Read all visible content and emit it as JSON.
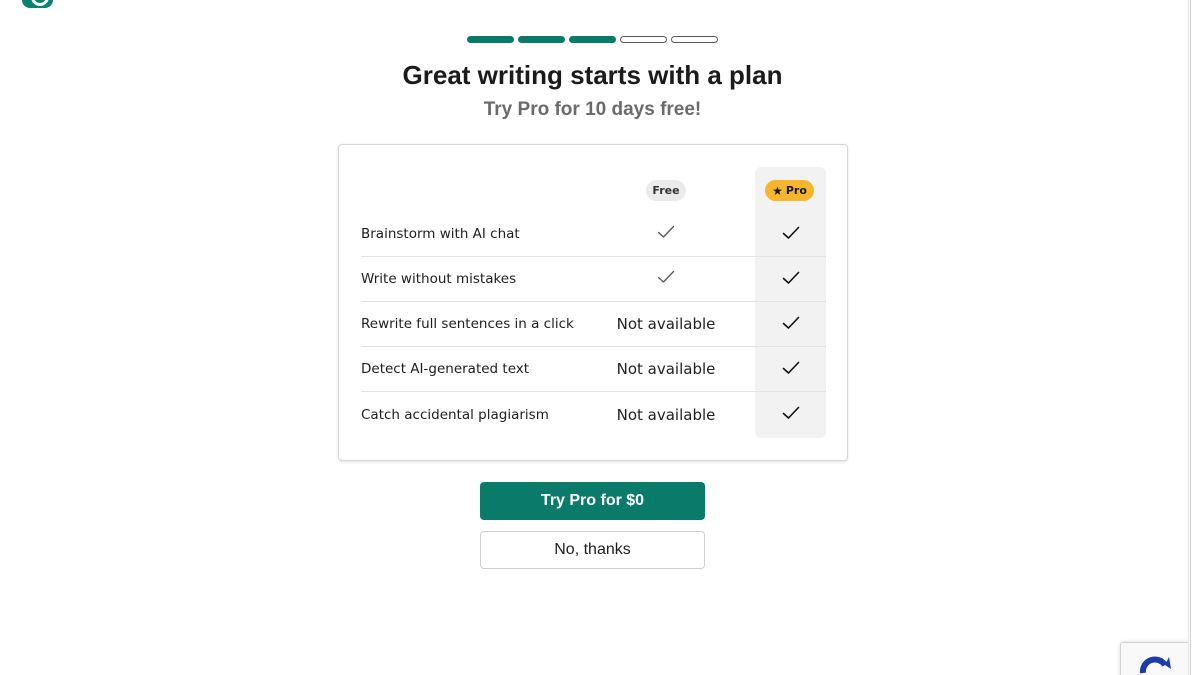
{
  "brand": {
    "name": "grammarly",
    "color": "#0a7b6b"
  },
  "progress": {
    "total_steps": 5,
    "completed_steps": 3
  },
  "header": {
    "title": "Great writing starts with a plan",
    "subtitle": "Try Pro for 10 days free!"
  },
  "plans": {
    "free_label": "Free",
    "pro_label": "Pro",
    "pro_badge_color": "#f6b52d"
  },
  "features": [
    {
      "name": "Brainstorm with AI chat",
      "free": "check",
      "pro": "check"
    },
    {
      "name": "Write without mistakes",
      "free": "check",
      "pro": "check"
    },
    {
      "name": "Rewrite full sentences in a click",
      "free": "Not available",
      "pro": "check"
    },
    {
      "name": "Detect AI-generated text",
      "free": "Not available",
      "pro": "check"
    },
    {
      "name": "Catch accidental plagiarism",
      "free": "Not available",
      "pro": "check"
    }
  ],
  "actions": {
    "primary_label": "Try Pro for $0",
    "secondary_label": "No, thanks"
  },
  "icons": {
    "check": "check-icon",
    "star": "star-icon",
    "recaptcha": "recaptcha-icon"
  }
}
